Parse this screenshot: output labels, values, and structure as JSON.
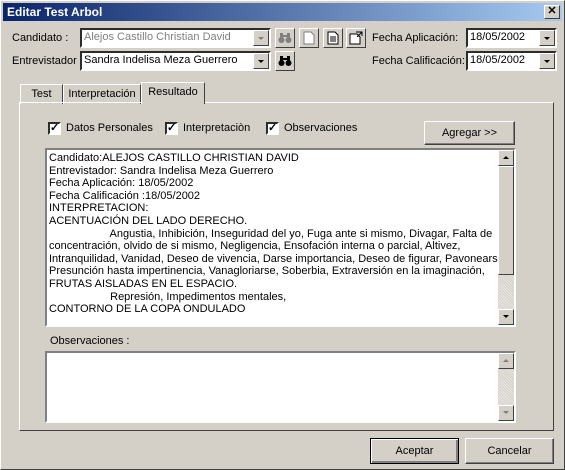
{
  "window": {
    "title": "Editar Test Arbol",
    "close_glyph": "✕"
  },
  "header": {
    "candidato_label": "Candidato :",
    "candidato_value": "Alejos Castillo Christian David",
    "entrevistador_label": "Entrevistador :",
    "entrevistador_value": "Sandra Indelisa Meza Guerrero",
    "fecha_aplicacion_label": "Fecha Aplicación:",
    "fecha_aplicacion_value": "18/05/2002",
    "fecha_calificacion_label": "Fecha Calificación:",
    "fecha_calificacion_value": "18/05/2002",
    "icons": [
      "binoculars-icon",
      "new-document-icon",
      "document-list-icon",
      "document-export-icon",
      "binoculars-icon"
    ]
  },
  "tabs": [
    {
      "label": "Test",
      "active": false
    },
    {
      "label": "Interpretación",
      "active": false
    },
    {
      "label": "Resultado",
      "active": true
    }
  ],
  "options": {
    "datos_personales": "Datos Personales",
    "interpretacion": "Interpretaciòn",
    "observaciones": "Observaciones",
    "agregar_button": "Agregar >>"
  },
  "result_text": [
    "Candidato:ALEJOS CASTILLO CHRISTIAN DAVID",
    "Entrevistador: Sandra Indelisa Meza Guerrero",
    "Fecha Aplicación: 18/05/2002",
    "Fecha Calificación :18/05/2002",
    "INTERPRETACION:",
    "ACENTUACIÓN DEL LADO DERECHO.",
    "                    Angustia, Inhibición, Inseguridad del yo, Fuga ante si mismo, Divagar, Falta de",
    "concentración, olvido de si mismo, Negligencia, Ensofación interna o parcial, Altivez,",
    "Intranquilidad, Vanidad, Deseo de vivencia, Darse importancia, Deseo de figurar, Pavonearse,",
    "Presunción hasta impertinencia, Vanagloriarse, Soberbia, Extraversión en la imaginación,",
    "FRUTAS AISLADAS EN EL ESPACIO.",
    "                    Represión, Impedimentos mentales,",
    "CONTORNO DE LA COPA ONDULADO"
  ],
  "observaciones_label": "Observaciones :",
  "observaciones_value": "",
  "footer": {
    "accept_label": "Aceptar",
    "cancel_label": "Cancelar"
  }
}
